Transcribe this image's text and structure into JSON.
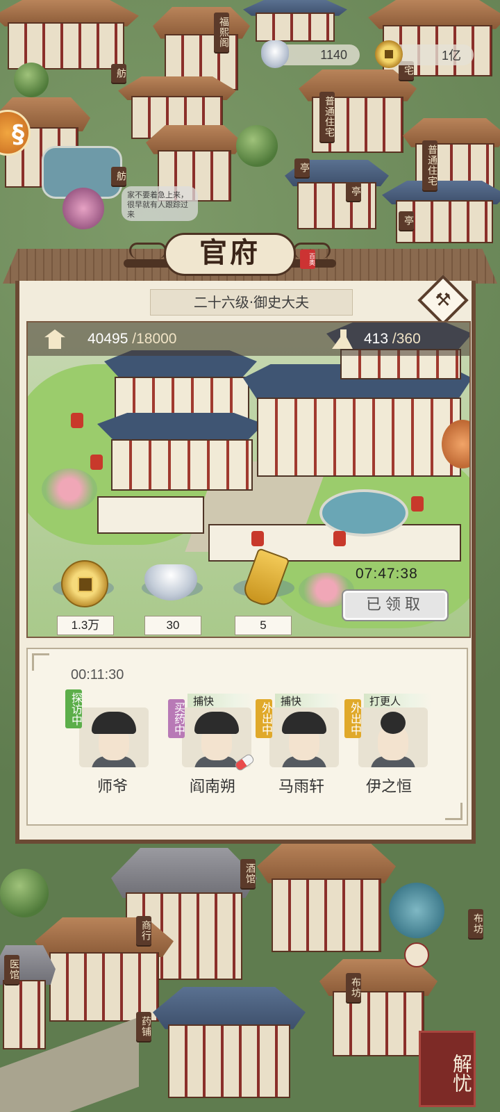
{
  "currency": {
    "silver": "1140",
    "copper": "1亿"
  },
  "map_labels": {
    "fuxiange": "福熙阁",
    "fang1": "舫",
    "fang2": "舫",
    "zhuzhai_top": "宅",
    "putong_zhuzhai1": "普通住宅",
    "putong_zhuzhai2": "普通住宅",
    "ting1": "亭",
    "ting2": "亭",
    "ting3": "亭",
    "jiuguan": "酒馆",
    "shanghang": "商行",
    "yiguan": "医馆",
    "bufang1": "布坊",
    "bufang2": "布坊",
    "yaopu": "药铺"
  },
  "speech_bubble": "家不要着急上来，很早就有人跟踪过来",
  "panel": {
    "title": "官府",
    "seal": "百奥",
    "rank": "二十六级·御史大夫",
    "stats": {
      "prosperity": "40495",
      "prosperity_max": "/18000",
      "population": "413",
      "population_max": "/360"
    },
    "resources": {
      "copper": "1.3万",
      "silver": "30",
      "token": "5"
    },
    "timer": "07:47:38",
    "claim_button": "已领取",
    "staff_countdown": "00:11:30",
    "staff": [
      {
        "name": "师爷",
        "status": "探访中",
        "role": ""
      },
      {
        "name": "阎南朔",
        "status": "买药中",
        "role": "捕快"
      },
      {
        "name": "马雨轩",
        "status": "外出中",
        "role": "捕快"
      },
      {
        "name": "伊之恒",
        "status": "外出中",
        "role": "打更人"
      }
    ]
  },
  "corner_button": "解忧",
  "colors": {
    "panel_border": "#6b4a34",
    "panel_bg": "#f2ecdc",
    "status_green": "#5cae4a",
    "status_purple": "#b879b6",
    "status_yellow": "#e0a92a"
  }
}
